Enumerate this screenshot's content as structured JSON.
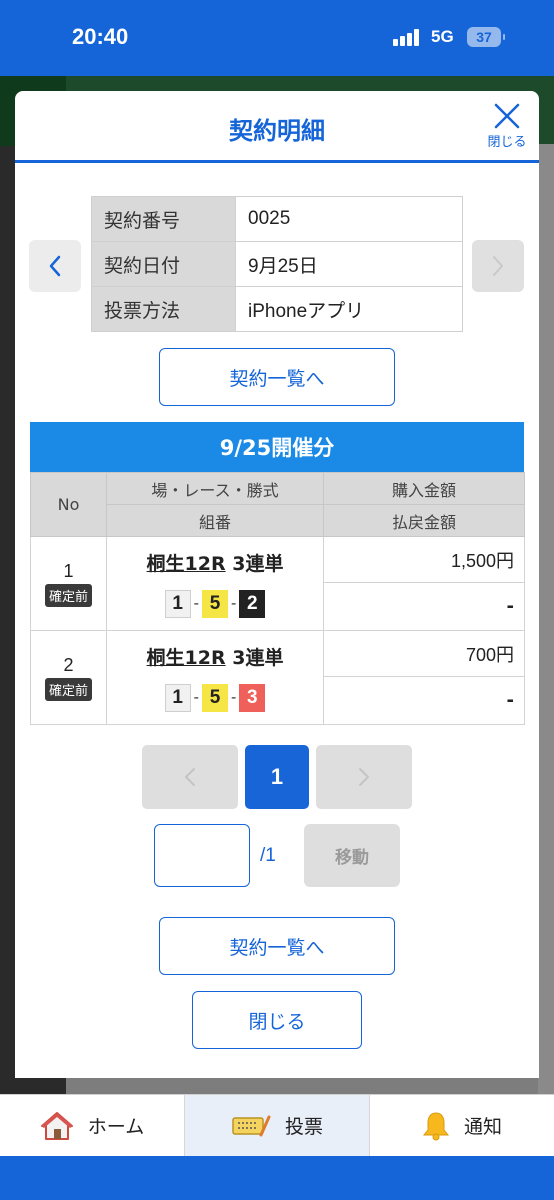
{
  "status_bar": {
    "time": "20:40",
    "network": "5G",
    "battery": "37"
  },
  "modal": {
    "title": "契約明細",
    "close_label": "閉じる"
  },
  "contract_info": {
    "rows": [
      {
        "key": "契約番号",
        "value": "0025"
      },
      {
        "key": "契約日付",
        "value": "9月25日"
      },
      {
        "key": "投票方法",
        "value": "iPhoneアプリ"
      }
    ]
  },
  "buttons": {
    "contract_list": "契約一覧へ",
    "close": "閉じる",
    "move": "移動"
  },
  "section": {
    "title": "9/25開催分"
  },
  "bet_table": {
    "headers": {
      "no": "No",
      "race": "場・レース・勝式",
      "combination": "組番",
      "purchase": "購入金額",
      "payout": "払戻金額"
    },
    "rows": [
      {
        "no": "1",
        "status": "確定前",
        "venue": "桐生12R",
        "type": "3連単",
        "combo": [
          "1",
          "5",
          "2"
        ],
        "separator": "-",
        "purchase": "1,500円",
        "payout": "-"
      },
      {
        "no": "2",
        "status": "確定前",
        "venue": "桐生12R",
        "type": "3連単",
        "combo": [
          "1",
          "5",
          "3"
        ],
        "separator": "-",
        "purchase": "700円",
        "payout": "-"
      }
    ]
  },
  "pagination": {
    "current": "1",
    "total": "/1",
    "input_value": ""
  },
  "tabbar": {
    "items": [
      {
        "label": "ホーム",
        "icon": "home-icon"
      },
      {
        "label": "投票",
        "icon": "ticket-icon"
      },
      {
        "label": "通知",
        "icon": "bell-icon"
      }
    ]
  },
  "colors": {
    "primary": "#1565d8",
    "section": "#1b8ae6",
    "boat1": "#f1f1f1",
    "boat2": "#222222",
    "boat3": "#f0605a",
    "boat5": "#f5e545"
  }
}
